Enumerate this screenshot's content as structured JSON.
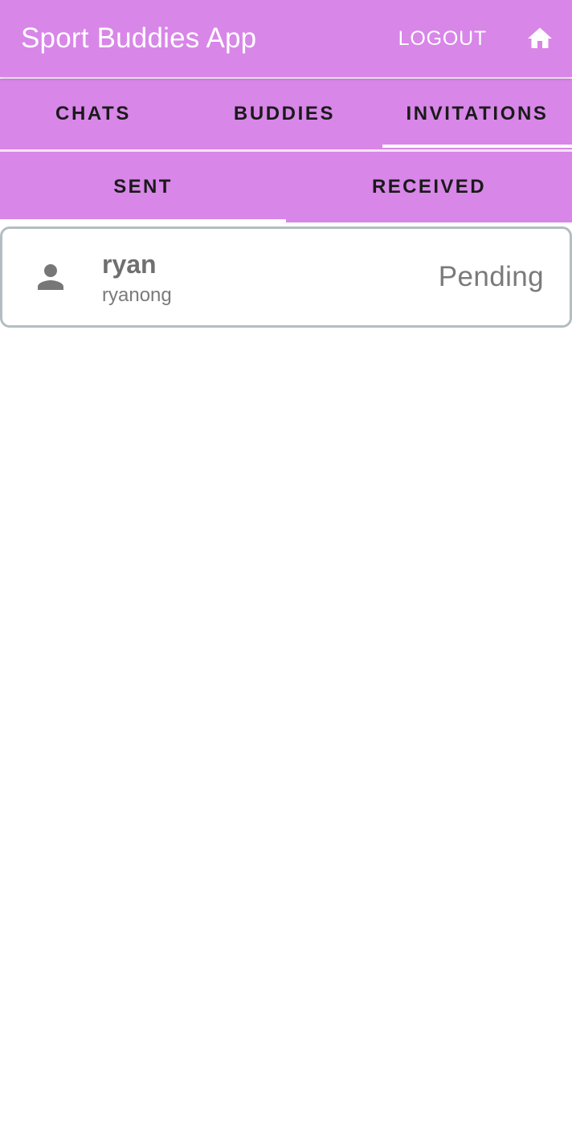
{
  "app_bar": {
    "title": "Sport Buddies App",
    "logout_label": "LOGOUT",
    "home_icon": "home-icon"
  },
  "main_tabs": [
    {
      "label": "CHATS",
      "selected": false
    },
    {
      "label": "BUDDIES",
      "selected": false
    },
    {
      "label": "INVITATIONS",
      "selected": true
    }
  ],
  "sub_tabs": [
    {
      "label": "SENT",
      "selected": true
    },
    {
      "label": "RECEIVED",
      "selected": false
    }
  ],
  "invitations": [
    {
      "name": "ryan",
      "username": "ryanong",
      "status": "Pending",
      "icon": "person-icon"
    }
  ],
  "colors": {
    "primary": "#d886e8",
    "on_primary": "#ffffff",
    "tab_text": "#1a1a1a",
    "card_border": "#b3bec2",
    "muted_text": "#7a7a7a"
  }
}
